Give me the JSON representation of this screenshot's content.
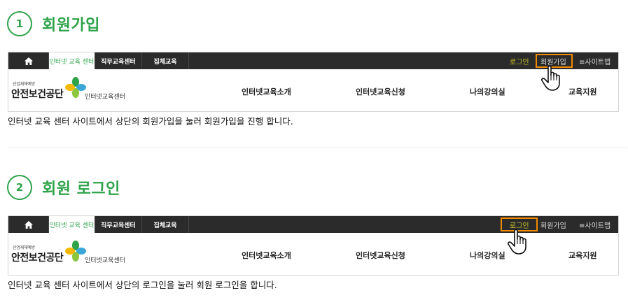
{
  "steps": [
    {
      "number": "1",
      "title": "회원가입",
      "highlight": "회원가입",
      "caption": "인터넷 교육 센터 사이트에서 상단의 회원가입을 눌러 회원가입을 진행 합니다."
    },
    {
      "number": "2",
      "title": "회원 로그인",
      "highlight": "로그인",
      "caption": "인터넷 교육 센터 사이트에서 상단의 로그인을 눌러 회원 로그인을 합니다."
    }
  ],
  "site": {
    "home_icon": "home-icon",
    "tabs": [
      "인터넷 교육 센터",
      "직무교육센터",
      "집체교육"
    ],
    "util_links": {
      "login": "로그인",
      "join": "회원가입",
      "sitemap": "≡사이트맵"
    },
    "logo_small": "산업재해예방",
    "logo_main": "안전보건공단",
    "logo_sub": "인터넷교육센터",
    "nav": [
      "인터넷교육소개",
      "인터넷교육신청",
      "나의강의실",
      "교육지원"
    ]
  },
  "colors": {
    "accent_green": "#2ea34a",
    "highlight_orange": "#f08a00",
    "topbar": "#2b2b2b",
    "login_text": "#c9c020"
  },
  "cursor_icon": "hand-pointer-icon"
}
